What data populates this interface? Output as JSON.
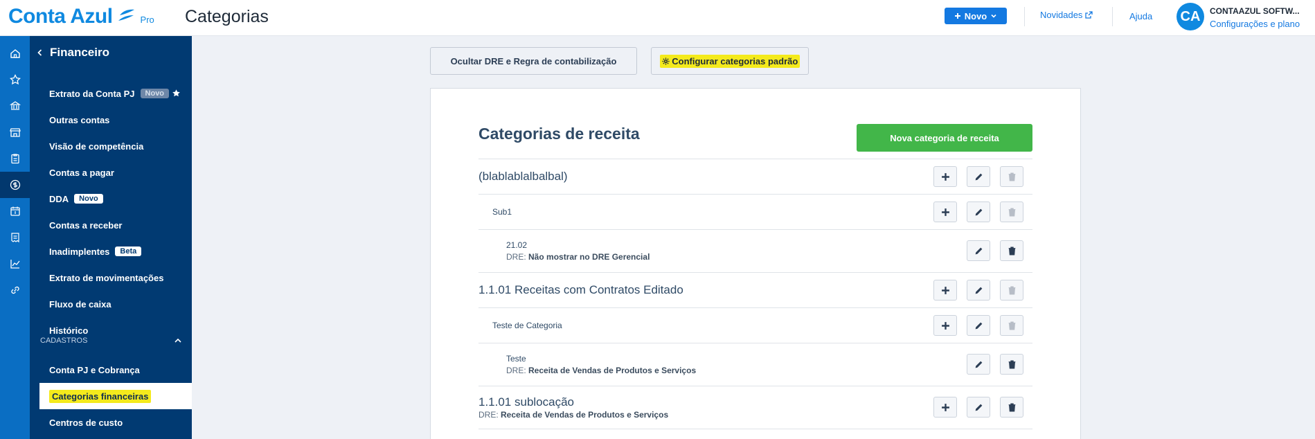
{
  "header": {
    "logo_text": "Conta Azul",
    "logo_pro": "Pro",
    "page_title": "Categorias",
    "novo_label": "Novo",
    "novidades_label": "Novidades",
    "ajuda_label": "Ajuda",
    "avatar_initials": "CA",
    "company_name": "CONTAAZUL SOFTW...",
    "config_label": "Configurações e plano"
  },
  "rail": {
    "icons": [
      "home-icon",
      "star-icon",
      "bank-icon",
      "store-icon",
      "clipboard-icon",
      "dollar-icon",
      "calendar-icon",
      "receipt-icon",
      "chart-icon",
      "link-icon"
    ],
    "active_index": 5
  },
  "sidebar": {
    "title": "Financeiro",
    "items": [
      {
        "label": "Extrato da Conta PJ",
        "badge": "Novo"
      },
      {
        "label": "Outras contas"
      },
      {
        "label": "Visão de competência"
      },
      {
        "label": "Contas a pagar"
      },
      {
        "label": "DDA",
        "badge": "Novo"
      },
      {
        "label": "Contas a receber"
      },
      {
        "label": "Inadimplentes",
        "badge": "Beta"
      },
      {
        "label": "Extrato de movimentações"
      },
      {
        "label": "Fluxo de caixa"
      },
      {
        "label": "Histórico"
      }
    ],
    "section_label": "CADASTROS",
    "section_items": [
      {
        "label": "Conta PJ e Cobrança"
      },
      {
        "label": "Categorias financeiras"
      },
      {
        "label": "Centros de custo"
      }
    ]
  },
  "main": {
    "ocultar_pre": "Ocultar ",
    "ocultar_dre": "DRE",
    "ocultar_mid": " e ",
    "ocultar_regra": "Regra de contabilização",
    "configurar_label": "Configurar categorias padrão",
    "card_title": "Categorias de receita",
    "nova_label": "Nova categoria de receita",
    "dre_prefix": "DRE: ",
    "rows": [
      {
        "name": "(blablablalbalbal)"
      },
      {
        "name": "Sub1"
      },
      {
        "name": "21.02",
        "dre": "Não mostrar no DRE Gerencial"
      },
      {
        "name": "1.1.01 Receitas com Contratos Editado"
      },
      {
        "name": "Teste de Categoria"
      },
      {
        "name": "Teste",
        "dre": "Receita de Vendas de Produtos e Serviços"
      },
      {
        "name": "1.1.01 sublocação",
        "dre": "Receita de Vendas de Produtos e Serviços"
      }
    ]
  }
}
